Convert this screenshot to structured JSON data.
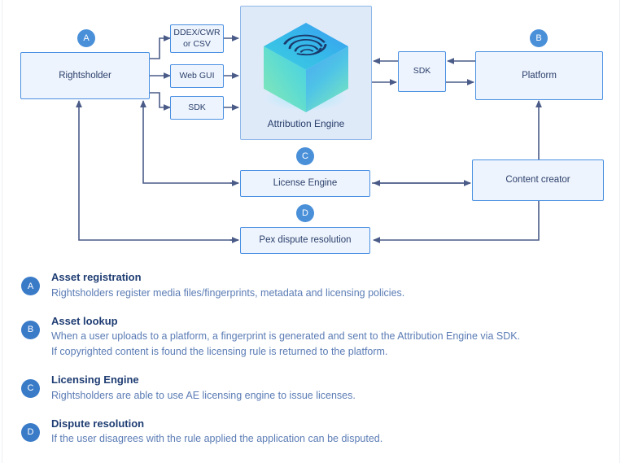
{
  "colors": {
    "node_fill": "#eef4fd",
    "node_border": "#4a90e2",
    "panel_fill": "#dfeaf9",
    "panel_border": "#8fb8e8",
    "wire": "#4a5b88",
    "badge_blue": "#4a90d9",
    "legend_badge_blue": "#3a7bc8",
    "title_navy": "#1f3d73",
    "body_blue": "#5b7cb5",
    "cube_top_a": "#3fd0e0",
    "cube_top_b": "#3aa0f0",
    "cube_left_a": "#7fe0b8",
    "cube_left_b": "#4ad2e8",
    "cube_right_a": "#4aa8f5",
    "cube_right_b": "#6fe0c8",
    "fingerprint": "#1b3a6b"
  },
  "diagram": {
    "nodes": {
      "rightsholder": "Rightsholder",
      "ddex": "DDEX/CWR\nor CSV",
      "ddex_line1": "DDEX/CWR",
      "ddex_line2": "or CSV",
      "webgui": "Web GUI",
      "sdk_left": "SDK",
      "attribution_engine": "Attribution Engine",
      "sdk_right": "SDK",
      "platform": "Platform",
      "license_engine": "License Engine",
      "content_creator": "Content creator",
      "pex_dispute": "Pex dispute resolution"
    },
    "badges": {
      "a": "A",
      "b": "B",
      "c": "C",
      "d": "D"
    }
  },
  "legend": {
    "items": [
      {
        "badge": "A",
        "title": "Asset registration",
        "lines": [
          "Rightsholders register media files/fingerprints, metadata and licensing policies."
        ]
      },
      {
        "badge": "B",
        "title": "Asset lookup",
        "lines": [
          "When a user uploads to a platform, a fingerprint is generated and sent to the Attribution Engine via SDK.",
          "If copyrighted content is found the licensing rule is returned to the platform."
        ]
      },
      {
        "badge": "C",
        "title": "Licensing Engine",
        "lines": [
          "Rightsholders are able to use AE licensing engine to issue licenses."
        ]
      },
      {
        "badge": "D",
        "title": "Dispute resolution",
        "lines": [
          "If the user disagrees with the rule applied the application can be disputed."
        ]
      }
    ]
  }
}
